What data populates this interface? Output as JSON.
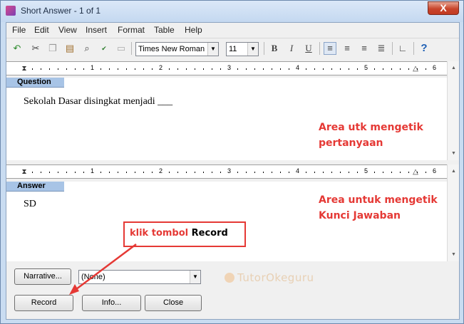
{
  "window": {
    "title": "Short Answer - 1 of 1",
    "close_glyph": "X"
  },
  "menu": [
    "File",
    "Edit",
    "View",
    "Insert",
    "Format",
    "Table",
    "Help"
  ],
  "toolbar": {
    "font": "Times New Roman",
    "size": "11",
    "bold": "B",
    "italic": "I",
    "underline": "U",
    "help": "?"
  },
  "ruler": {
    "numbers": [
      "1",
      "2",
      "3",
      "4",
      "5",
      "6"
    ]
  },
  "question": {
    "label": "Question",
    "text": "Sekolah Dasar disingkat menjadi ___"
  },
  "answer": {
    "label": "Answer",
    "text": "SD"
  },
  "annotations": {
    "question_area": [
      "Area utk mengetik",
      "pertanyaan"
    ],
    "answer_area": [
      "Area untuk mengetik",
      "Kunci Jawaban"
    ],
    "callout_prefix": "klik tombol ",
    "callout_strong": "Record"
  },
  "bottom": {
    "narrative_button": "Narrative...",
    "narrative_select": "(None)",
    "record_button": "Record",
    "info_button": "Info...",
    "close_button": "Close"
  },
  "watermark": "TutorOkeguru",
  "colors": {
    "annotation": "#e53935",
    "section_label": "#a8c4e6",
    "window_frame": "#c9dcf1"
  }
}
